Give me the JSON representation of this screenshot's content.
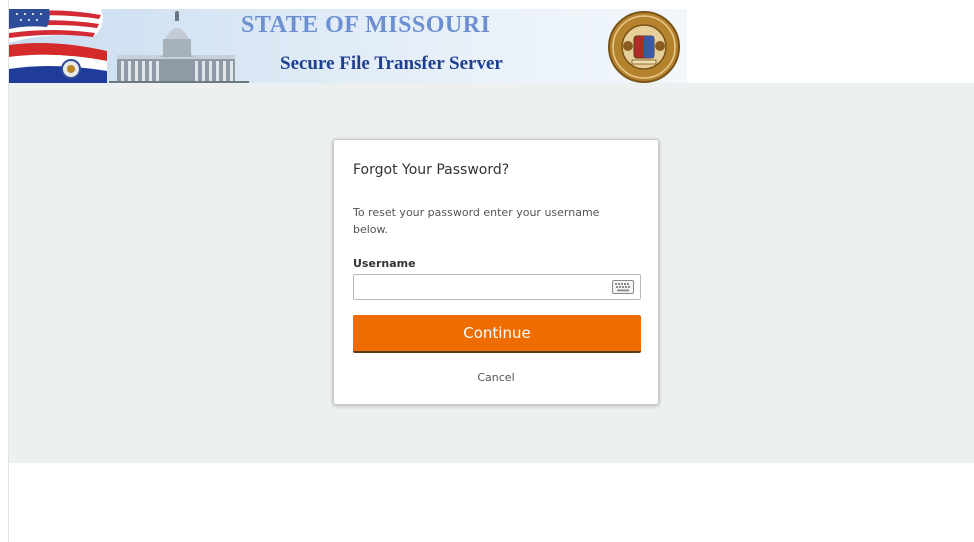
{
  "header": {
    "title": "STATE OF MISSOURI",
    "subtitle": "Secure File Transfer Server",
    "icons": [
      "us-flag",
      "capitol-building",
      "missouri-flag",
      "state-seal"
    ]
  },
  "dialog": {
    "title": "Forgot Your Password?",
    "description": "To reset your password enter your username below.",
    "username_label": "Username",
    "username_value": "",
    "keyboard_icon": "virtual-keyboard-icon",
    "continue_label": "Continue",
    "cancel_label": "Cancel"
  },
  "colors": {
    "accent": "#ef6c00",
    "background": "#edf0f0",
    "title_light_blue": "#6d8fd0",
    "subtitle_dark_blue": "#1f3f8e"
  }
}
